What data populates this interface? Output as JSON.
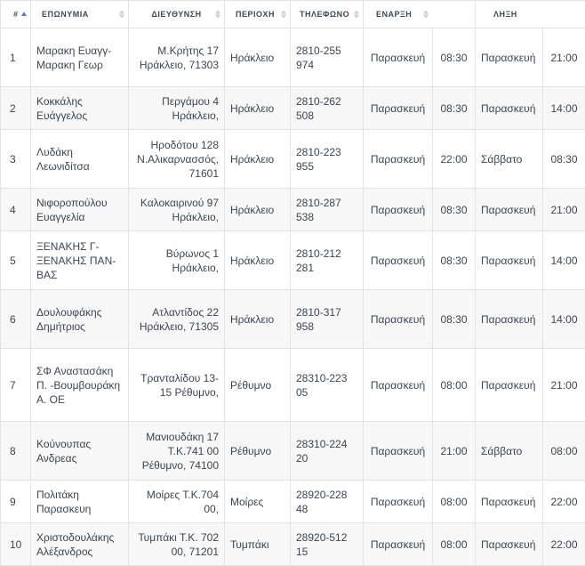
{
  "columns": {
    "num": "#",
    "name": "ΕΠΩΝΥΜΙΑ",
    "address": "ΔΙΕΥΘΥΝΣΗ",
    "area": "ΠΕΡΙΟΧΗ",
    "phone": "ΤΗΛΕΦΩΝΟ",
    "start": "ΕΝΑΡΞΗ",
    "end": "ΛΗΞΗ"
  },
  "rows": [
    {
      "num": "1",
      "name": "Μαρακη Ευαγγ-Μαρακη Γεωρ",
      "address": "Μ.Κρήτης 17 Ηράκλειο, 71303",
      "area": "Ηράκλειο",
      "phone": "2810-255 974",
      "start_day": "Παρασκευή",
      "start_time": "08:30",
      "end_day": "Παρασκευή",
      "end_time": "21:00"
    },
    {
      "num": "2",
      "name": "Κοκκάλης Ευάγγελος",
      "address": "Περγάμου 4 Ηράκλειο,",
      "area": "Ηράκλειο",
      "phone": "2810-262 508",
      "start_day": "Παρασκευή",
      "start_time": "08:30",
      "end_day": "Παρασκευή",
      "end_time": "14:00"
    },
    {
      "num": "3",
      "name": "Λυδάκη Λεωνιδίτσα",
      "address": "Ηροδότου 128 Ν.Αλικαρνασσός, 71601",
      "area": "Ηράκλειο",
      "phone": "2810-223 955",
      "start_day": "Παρασκευή",
      "start_time": "22:00",
      "end_day": "Σάββατο",
      "end_time": "08:30"
    },
    {
      "num": "4",
      "name": "Νιφοροπούλου Ευαγγελία",
      "address": "Καλοκαιρινού 97 Ηράκλειο,",
      "area": "Ηράκλειο",
      "phone": "2810-287 538",
      "start_day": "Παρασκευή",
      "start_time": "08:30",
      "end_day": "Παρασκευή",
      "end_time": "21:00"
    },
    {
      "num": "5",
      "name": "ΞΕΝΑΚΗΣ Γ-ΞΕΝΑΚΗΣ ΠΑΝ-ΒΑΣ",
      "address": "Βύρωνος 1 Ηράκλειο,",
      "area": "Ηράκλειο",
      "phone": "2810-212 281",
      "start_day": "Παρασκευή",
      "start_time": "08:30",
      "end_day": "Παρασκευή",
      "end_time": "14:00"
    },
    {
      "num": "6",
      "name": "Δουλουφάκης Δημήτριος",
      "address": "Ατλαντίδος 22 Ηράκλειο, 71305",
      "area": "Ηράκλειο",
      "phone": "2810-317 958",
      "start_day": "Παρασκευή",
      "start_time": "08:30",
      "end_day": "Παρασκευή",
      "end_time": "14:00"
    },
    {
      "num": "7",
      "name": "ΣΦ Αναστασάκη Π. -Βουμβουράκη Α. ΟΕ",
      "address": "Τρανταλίδου 13-15 Ρέθυμνο,",
      "area": "Ρέθυμνο",
      "phone": "28310-223 05",
      "start_day": "Παρασκευή",
      "start_time": "08:00",
      "end_day": "Παρασκευή",
      "end_time": "21:00"
    },
    {
      "num": "8",
      "name": "Κούνουπας Ανδρεας",
      "address": "Μανιουδάκη 17 Τ.Κ.741 00 Ρέθυμνο, 74100",
      "area": "Ρέθυμνο",
      "phone": "28310-224 20",
      "start_day": "Παρασκευή",
      "start_time": "21:00",
      "end_day": "Σάββατο",
      "end_time": "08:00"
    },
    {
      "num": "9",
      "name": "Πολιτάκη Παρασκευη",
      "address": "Μοίρες Τ.Κ.704 00,",
      "area": "Μοίρες",
      "phone": "28920-228 48",
      "start_day": "Παρασκευή",
      "start_time": "08:00",
      "end_day": "Παρασκευή",
      "end_time": "22:00"
    },
    {
      "num": "10",
      "name": "Χριστοδουλάκης Αλέξανδρος",
      "address": "Τυμπάκι Τ.Κ. 702 00, 71201",
      "area": "Τυμπάκι",
      "phone": "28920-512 15",
      "start_day": "Παρασκευή",
      "start_time": "08:00",
      "end_day": "Παρασκευή",
      "end_time": "22:00"
    }
  ]
}
